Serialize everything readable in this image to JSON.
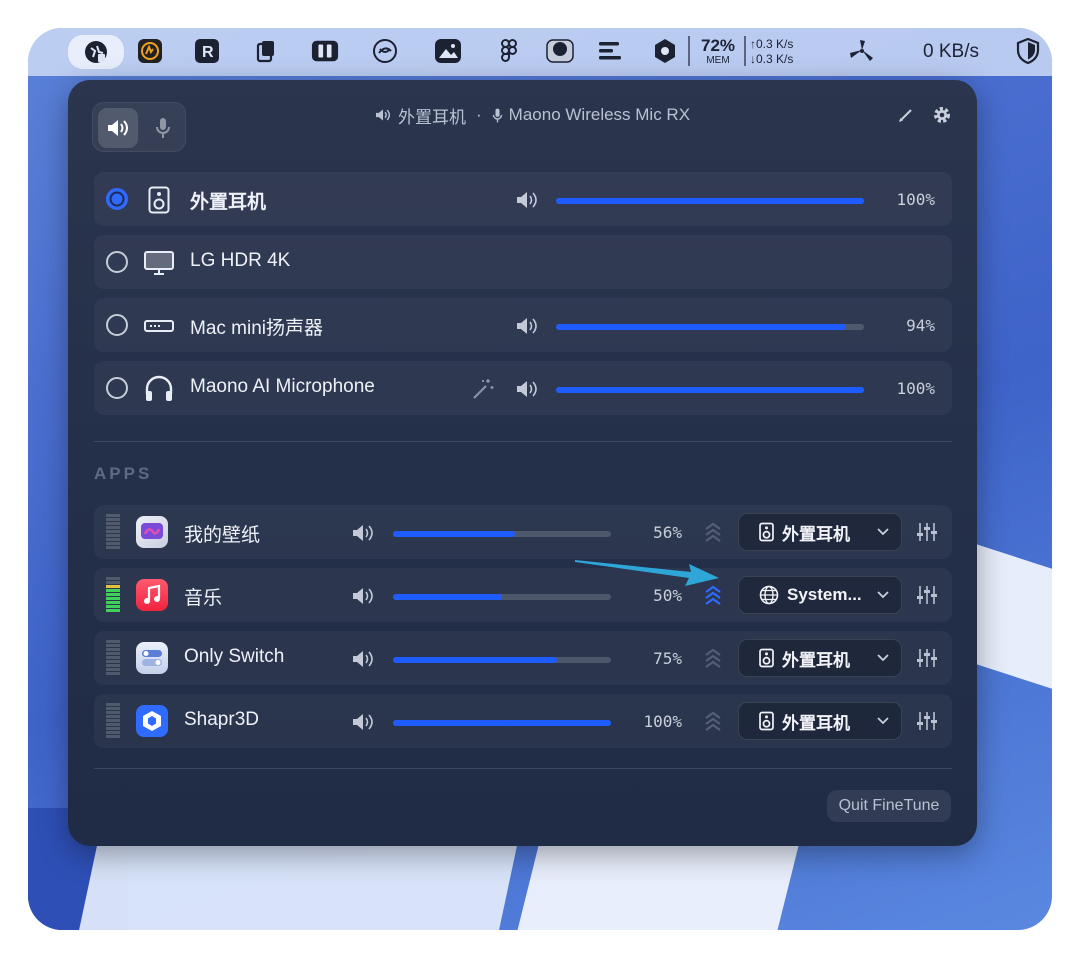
{
  "menubar": {
    "mem_percent": "72%",
    "mem_label": "MEM",
    "up_speed": "↑0.3 K/s",
    "down_speed": "↓0.3 K/s",
    "net_speed": "0 KB/s",
    "icons": [
      "finetune-icon",
      "activity-icon",
      "r-app-icon",
      "clipboard-icon",
      "switch-icon",
      "fan-icon",
      "image-icon",
      "figma-icon",
      "disk-icon",
      "list-icon",
      "hexagon-icon",
      "fan-blades-icon",
      "shield-icon"
    ]
  },
  "header": {
    "output_device": "外置耳机",
    "separator": "·",
    "input_device": "Maono Wireless Mic RX"
  },
  "devices": [
    {
      "name": "外置耳机",
      "selected": true,
      "icon": "speaker-icon",
      "volume": "100%",
      "level": 1.0,
      "has_volume": true
    },
    {
      "name": "LG HDR 4K",
      "selected": false,
      "icon": "monitor-icon",
      "has_volume": false
    },
    {
      "name": "Mac mini扬声器",
      "selected": false,
      "icon": "mac-mini-icon",
      "volume": "94%",
      "level": 0.94,
      "has_volume": true
    },
    {
      "name": "Maono AI Microphone",
      "selected": false,
      "icon": "headphones-icon",
      "volume": "100%",
      "level": 1.0,
      "has_volume": true,
      "magic": true
    }
  ],
  "apps_section": "APPS",
  "apps": [
    {
      "name": "我的壁纸",
      "volume": "56%",
      "level": 0.56,
      "route": "外置耳机",
      "route_icon": "speaker-icon",
      "boost_active": false,
      "meter_live": false
    },
    {
      "name": "音乐",
      "volume": "50%",
      "level": 0.5,
      "route": "System...",
      "route_icon": "globe-icon",
      "boost_active": true,
      "meter_live": true
    },
    {
      "name": "Only Switch",
      "volume": "75%",
      "level": 0.75,
      "route": "外置耳机",
      "route_icon": "speaker-icon",
      "boost_active": false,
      "meter_live": false
    },
    {
      "name": "Shapr3D",
      "volume": "100%",
      "level": 1.0,
      "route": "外置耳机",
      "route_icon": "speaker-icon",
      "boost_active": false,
      "meter_live": false
    }
  ],
  "footer": {
    "quit_label": "Quit FineTune"
  },
  "colors": {
    "accent": "#1f5cff",
    "panel": "#25304a",
    "arrow": "#2ea6d8"
  }
}
